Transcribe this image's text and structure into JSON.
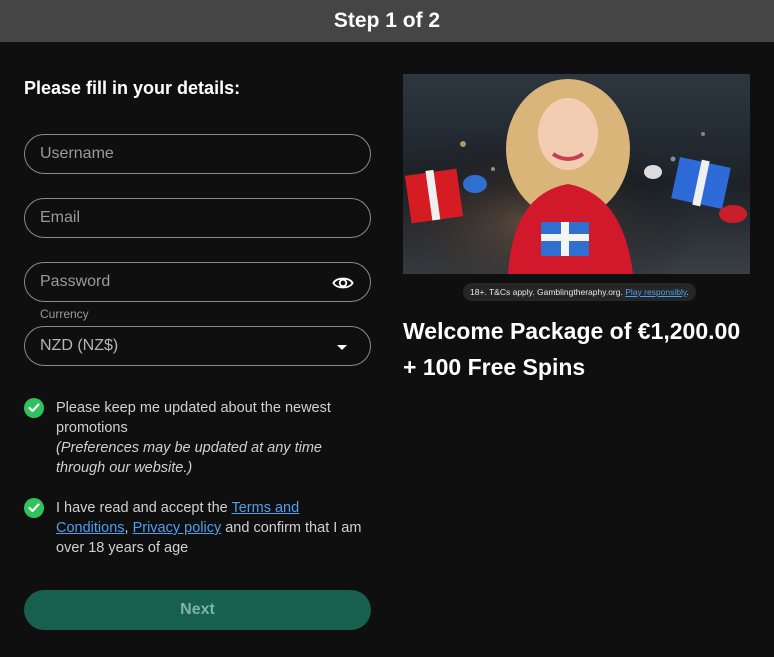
{
  "header": {
    "title": "Step 1 of 2"
  },
  "form": {
    "heading": "Please fill in your details:",
    "username": {
      "placeholder": "Username",
      "value": ""
    },
    "email": {
      "placeholder": "Email",
      "value": ""
    },
    "password": {
      "placeholder": "Password",
      "value": "",
      "icon": "eye-icon"
    },
    "currency": {
      "label": "Currency",
      "selected": "NZD (NZ$)",
      "icon": "caret-down-icon"
    },
    "promotions": {
      "checked": true,
      "text": "Please keep me updated about the newest promotions",
      "note": "(Preferences may be updated at any time through our website.)"
    },
    "terms": {
      "checked": true,
      "text_before": "I have read and accept the ",
      "terms_link": "Terms and Conditions",
      "separator": ", ",
      "privacy_link": "Privacy policy",
      "text_after": " and confirm that I am over 18 years of age"
    },
    "next_label": "Next"
  },
  "promo": {
    "disclaimer_text": "18+. T&Cs apply. Gamblingtheraphy.org. ",
    "disclaimer_link": "Play responsibly",
    "disclaimer_end": ".",
    "title": "Welcome Package of €1,200.00 + 100 Free Spins"
  },
  "colors": {
    "background": "#0f0f0f",
    "topbar": "#454545",
    "accent_green": "#2fc35e",
    "button": "#17604e",
    "link": "#4d9ff0"
  }
}
